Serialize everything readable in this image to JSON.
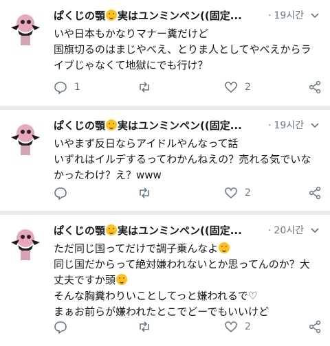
{
  "tweets": [
    {
      "name": "ぱくじの顎",
      "name_suffix": "実はユンミンペン((固定...",
      "time": "19시간",
      "lines": [
        "いや日本もかなりマナー糞だけど",
        "国旗切るのはまじやべえ、とりま人としてやべえからラ",
        "イブじゃなくて地獄にでも行け？"
      ],
      "reply_count": "1",
      "retweet_count": "",
      "like_count": "2"
    },
    {
      "name": "ぱくじの顎",
      "name_suffix": "実はユンミンペン((固定...",
      "time": "19시간",
      "lines": [
        "いやまず反日ならアイドルやんなって話",
        "いずれはイルデするってわかんねえの？売れる気でいな",
        "かったわけ？え？www"
      ],
      "reply_count": "",
      "retweet_count": "",
      "like_count": "2"
    },
    {
      "name": "ぱくじの顎",
      "name_suffix": "実はユンミンペン((固定...",
      "time": "20시간",
      "lines": [
        "ただ同じ国ってだけで調子乗んなよ",
        "同じ国だからって絶対嫌われないとか思ってんのか？大",
        "丈夫ですか頭",
        "そんな胸糞わりいことしてっと嫌われるで♡",
        "まぁお前らが嫌われたとこでどーでもいいけど"
      ],
      "reply_count": "",
      "retweet_count": "",
      "like_count": "2"
    }
  ],
  "colors": {
    "text": "#14171a",
    "secondary": "#657786",
    "separator": "#e6ecf0",
    "emoji": "#fcc21b"
  }
}
